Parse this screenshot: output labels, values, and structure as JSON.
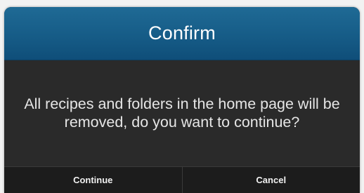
{
  "dialog": {
    "title": "Confirm",
    "message": "All recipes and folders in the home page will be removed, do you want to continue?",
    "buttons": {
      "continue_label": "Continue",
      "cancel_label": "Cancel"
    }
  },
  "colors": {
    "header": "#165c87",
    "body": "#2a2a2a",
    "actions": "#1c1c1c",
    "text": "#ffffff"
  }
}
